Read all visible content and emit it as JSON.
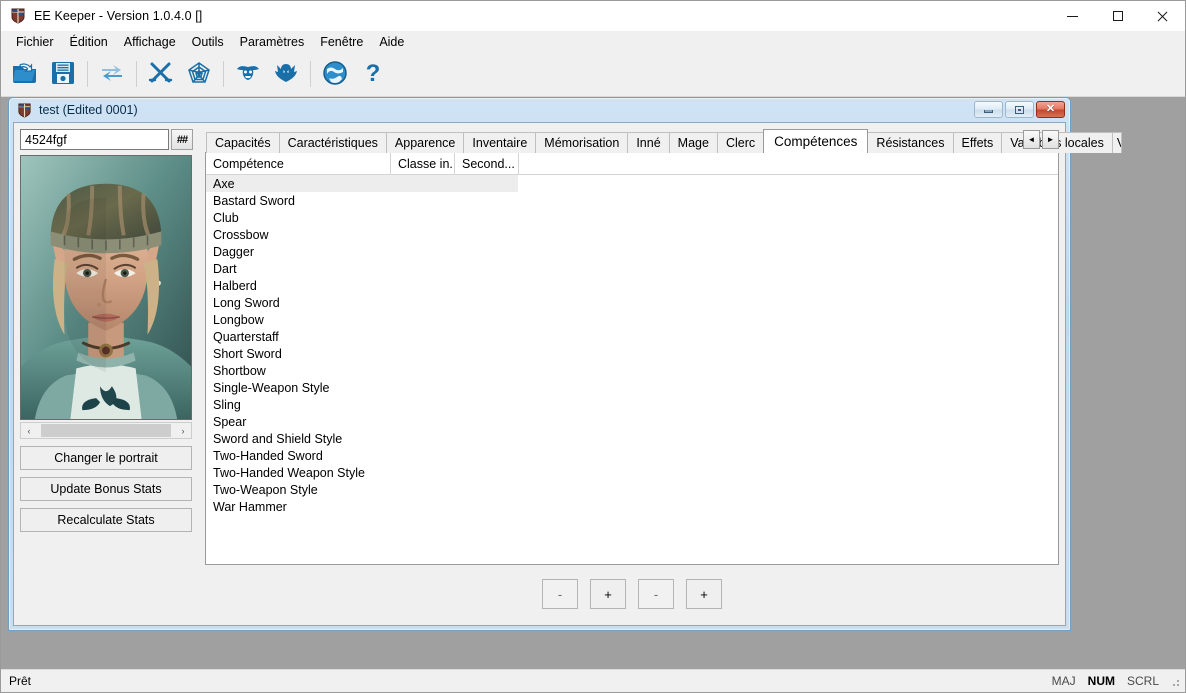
{
  "window": {
    "title": "EE Keeper - Version 1.0.4.0 []",
    "icon": "shield-icon",
    "controls": {
      "minimize": "minimize",
      "maximize": "maximize",
      "close": "close"
    }
  },
  "menubar": {
    "items": [
      {
        "label": "Fichier"
      },
      {
        "label": "Édition"
      },
      {
        "label": "Affichage"
      },
      {
        "label": "Outils"
      },
      {
        "label": "Paramètres"
      },
      {
        "label": "Fenêtre"
      },
      {
        "label": "Aide"
      }
    ]
  },
  "toolbar": {
    "buttons": [
      {
        "icon": "open-folder-icon",
        "tooltip": "Ouvrir"
      },
      {
        "icon": "save-floppy-icon",
        "tooltip": "Enregistrer"
      },
      {
        "icon": "refresh-arrows-icon",
        "tooltip": "Actualiser"
      },
      {
        "icon": "crossed-swords-icon",
        "tooltip": "Armes"
      },
      {
        "icon": "spider-web-icon",
        "tooltip": "Toile"
      },
      {
        "icon": "goblin-head-icon",
        "tooltip": "Créature"
      },
      {
        "icon": "demon-head-icon",
        "tooltip": "Démon"
      },
      {
        "icon": "globe-icon",
        "tooltip": "Global"
      },
      {
        "icon": "question-mark-icon",
        "tooltip": "Aide"
      }
    ]
  },
  "child_window": {
    "title": "test (Edited 0001)",
    "icon": "shield-icon",
    "controls": {
      "minimize": "minimize",
      "restore": "restore",
      "close": "close"
    }
  },
  "left_panel": {
    "name_field": {
      "value": "4524fgf",
      "placeholder": ""
    },
    "hash_button": "##",
    "portrait": {
      "name": "character-portrait",
      "alt": "Elf character portrait"
    },
    "scrollbar": {
      "left_arrow": "‹",
      "right_arrow": "›"
    },
    "buttons": [
      {
        "label": "Changer le portrait",
        "name": "change-portrait-button"
      },
      {
        "label": "Update Bonus Stats",
        "name": "update-bonus-stats-button"
      },
      {
        "label": "Recalculate Stats",
        "name": "recalculate-stats-button"
      }
    ]
  },
  "tabs": {
    "items": [
      {
        "label": "Capacités",
        "active": false
      },
      {
        "label": "Caractéristiques",
        "active": false
      },
      {
        "label": "Apparence",
        "active": false
      },
      {
        "label": "Inventaire",
        "active": false
      },
      {
        "label": "Mémorisation",
        "active": false
      },
      {
        "label": "Inné",
        "active": false
      },
      {
        "label": "Mage",
        "active": false
      },
      {
        "label": "Clerc",
        "active": false
      },
      {
        "label": "Compétences",
        "active": true
      },
      {
        "label": "Résistances",
        "active": false
      },
      {
        "label": "Effets",
        "active": false
      },
      {
        "label": "Variables locales",
        "active": false
      },
      {
        "label": "Va",
        "active": false,
        "clipped": true
      }
    ],
    "scroll_prev": "◄",
    "scroll_next": "►"
  },
  "skills_grid": {
    "columns": [
      "Compétence",
      "Classe in...",
      "Second..."
    ],
    "selected_index": 0,
    "rows": [
      {
        "skill": "Axe",
        "class_in": "",
        "second": ""
      },
      {
        "skill": "Bastard Sword",
        "class_in": "",
        "second": ""
      },
      {
        "skill": "Club",
        "class_in": "",
        "second": ""
      },
      {
        "skill": "Crossbow",
        "class_in": "",
        "second": ""
      },
      {
        "skill": "Dagger",
        "class_in": "",
        "second": ""
      },
      {
        "skill": "Dart",
        "class_in": "",
        "second": ""
      },
      {
        "skill": "Halberd",
        "class_in": "",
        "second": ""
      },
      {
        "skill": "Long Sword",
        "class_in": "",
        "second": ""
      },
      {
        "skill": "Longbow",
        "class_in": "",
        "second": ""
      },
      {
        "skill": "Quarterstaff",
        "class_in": "",
        "second": ""
      },
      {
        "skill": "Short Sword",
        "class_in": "",
        "second": ""
      },
      {
        "skill": "Shortbow",
        "class_in": "",
        "second": ""
      },
      {
        "skill": "Single-Weapon Style",
        "class_in": "",
        "second": ""
      },
      {
        "skill": "Sling",
        "class_in": "",
        "second": ""
      },
      {
        "skill": "Spear",
        "class_in": "",
        "second": ""
      },
      {
        "skill": "Sword and Shield Style",
        "class_in": "",
        "second": ""
      },
      {
        "skill": "Two-Handed Sword",
        "class_in": "",
        "second": ""
      },
      {
        "skill": "Two-Handed Weapon Style",
        "class_in": "",
        "second": ""
      },
      {
        "skill": "Two-Weapon Style",
        "class_in": "",
        "second": ""
      },
      {
        "skill": "War Hammer",
        "class_in": "",
        "second": ""
      }
    ]
  },
  "stepper_buttons": [
    {
      "label": "-",
      "name": "class-decrement-button",
      "dim": true
    },
    {
      "label": "+",
      "name": "class-increment-button",
      "dim": false
    },
    {
      "label": "-",
      "name": "second-decrement-button",
      "dim": true
    },
    {
      "label": "+",
      "name": "second-increment-button",
      "dim": false
    }
  ],
  "statusbar": {
    "message": "Prêt",
    "indicators": [
      {
        "label": "MAJ",
        "active": false
      },
      {
        "label": "NUM",
        "active": true
      },
      {
        "label": "SCRL",
        "active": false
      }
    ]
  },
  "colors": {
    "accent_blue": "#1b6fa8",
    "mdi_background": "#a0a0a0",
    "selection_gray": "#ededed",
    "child_frame": "#c8dff2"
  }
}
